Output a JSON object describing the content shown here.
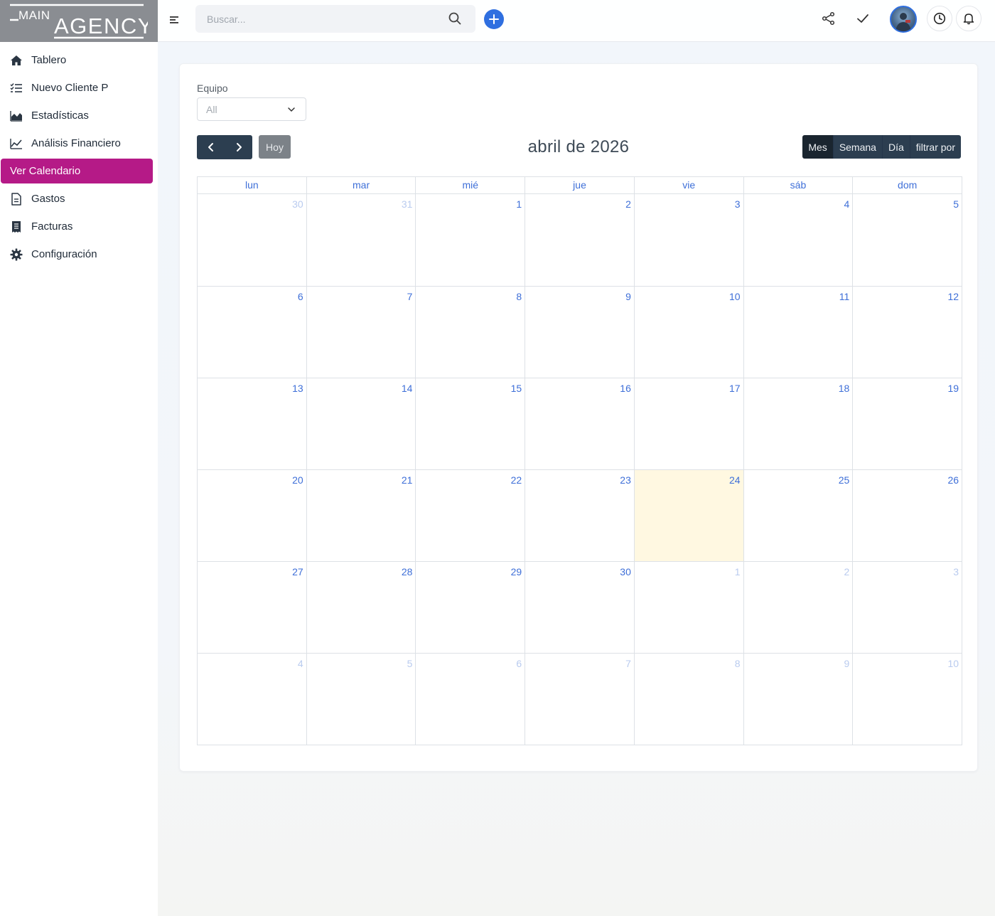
{
  "app": {
    "logo_text": "MAIN AGENCY"
  },
  "sidebar": {
    "items": [
      {
        "label": "Tablero",
        "icon": "home-icon"
      },
      {
        "label": "Nuevo Cliente P",
        "icon": "checklist-icon"
      },
      {
        "label": "Estadísticas",
        "icon": "area-chart-icon"
      },
      {
        "label": "Análisis Financiero",
        "icon": "line-chart-icon"
      },
      {
        "label": "Ver Calendario",
        "icon": "calendar-icon",
        "active": true
      },
      {
        "label": "Gastos",
        "icon": "document-icon"
      },
      {
        "label": "Facturas",
        "icon": "receipt-icon"
      },
      {
        "label": "Configuración",
        "icon": "gear-icon"
      }
    ]
  },
  "header": {
    "search_placeholder": "Buscar...",
    "icons": [
      "menu-icon",
      "search-icon",
      "plus-icon",
      "share-icon",
      "check-icon",
      "avatar",
      "clock-icon",
      "bell-icon"
    ]
  },
  "filter": {
    "label": "Equipo",
    "selected": "All"
  },
  "toolbar": {
    "today_label": "Hoy",
    "title": "abril de 2026",
    "views": [
      {
        "label": "Mes",
        "active": true
      },
      {
        "label": "Semana"
      },
      {
        "label": "Día"
      },
      {
        "label": "filtrar por"
      }
    ]
  },
  "calendar": {
    "weekdays": [
      "lun",
      "mar",
      "mié",
      "jue",
      "vie",
      "sáb",
      "dom"
    ],
    "weeks": [
      [
        {
          "d": "30",
          "o": true
        },
        {
          "d": "31",
          "o": true
        },
        {
          "d": "1"
        },
        {
          "d": "2"
        },
        {
          "d": "3"
        },
        {
          "d": "4"
        },
        {
          "d": "5"
        }
      ],
      [
        {
          "d": "6"
        },
        {
          "d": "7"
        },
        {
          "d": "8"
        },
        {
          "d": "9"
        },
        {
          "d": "10"
        },
        {
          "d": "11"
        },
        {
          "d": "12"
        }
      ],
      [
        {
          "d": "13"
        },
        {
          "d": "14"
        },
        {
          "d": "15"
        },
        {
          "d": "16"
        },
        {
          "d": "17"
        },
        {
          "d": "18"
        },
        {
          "d": "19"
        }
      ],
      [
        {
          "d": "20"
        },
        {
          "d": "21"
        },
        {
          "d": "22"
        },
        {
          "d": "23"
        },
        {
          "d": "24",
          "today": true
        },
        {
          "d": "25"
        },
        {
          "d": "26"
        }
      ],
      [
        {
          "d": "27"
        },
        {
          "d": "28"
        },
        {
          "d": "29"
        },
        {
          "d": "30"
        },
        {
          "d": "1",
          "o": true
        },
        {
          "d": "2",
          "o": true
        },
        {
          "d": "3",
          "o": true
        }
      ],
      [
        {
          "d": "4",
          "o": true
        },
        {
          "d": "5",
          "o": true
        },
        {
          "d": "6",
          "o": true
        },
        {
          "d": "7",
          "o": true
        },
        {
          "d": "8",
          "o": true
        },
        {
          "d": "9",
          "o": true
        },
        {
          "d": "10",
          "o": true
        }
      ]
    ]
  },
  "colors": {
    "accent": "#b51a87",
    "primary": "#2f6fe0",
    "dark_button": "#2c3e50",
    "today_bg": "#fff8e1",
    "link_blue": "#3e6fd8"
  }
}
